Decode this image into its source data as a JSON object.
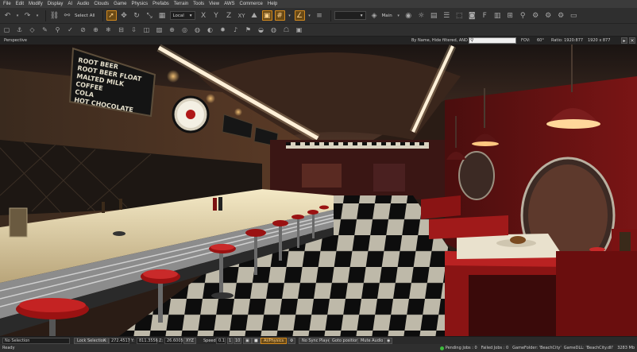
{
  "menu": [
    "File",
    "Edit",
    "Modify",
    "Display",
    "AI",
    "Audio",
    "Clouds",
    "Game",
    "Physics",
    "Prefabs",
    "Terrain",
    "Tools",
    "View",
    "AWS",
    "Commerce",
    "Help"
  ],
  "toolbar": {
    "select_all": "Select All",
    "coord_space": "Local",
    "axis_x": "X",
    "axis_y": "Y",
    "axis_z": "Z",
    "axis_xy": "XY",
    "layer_label": "Main"
  },
  "viewport_header": {
    "view_name": "Perspective",
    "filter_text": "By Name, Hide filtered, AND",
    "search_placeholder": "",
    "fov_label": "FOV:",
    "fov_value": "60°",
    "ratio_label": "Ratio: 1920:877",
    "resolution": "1920 x 877"
  },
  "scene": {
    "menu_board_lines": [
      "ROOT BEER",
      "ROOT BEER FLOAT",
      "MALTED MILK",
      "COFFEE",
      "COLA",
      "HOT CHOCOLATE"
    ]
  },
  "statusbar": {
    "selection": "No Selection",
    "lock_selection": "Lock Selection",
    "x_label": "X:",
    "x_value": "272.4517",
    "y_label": "Y:",
    "y_value": "811.3556",
    "z_label": "Z:",
    "z_value": "26.6005",
    "xyz_toggle": "XYZ",
    "speed_label": "Speed:",
    "speed_value": "0.1",
    "speed_1": "1",
    "speed_10": "10",
    "ai_physics": "AI/Physics",
    "no_sync": "No Sync Player",
    "goto_position": "Goto position",
    "mute_audio": "Mute Audio"
  },
  "status_footer": {
    "ready": "Ready",
    "pending_jobs": "Pending Jobs : 0",
    "failed_jobs": "Failed Jobs : 0",
    "game_folder": "GameFolder: 'BeachCity'",
    "game_dll": "GameDLL: 'BeachCity.dll'",
    "memory": "3283 Mb"
  },
  "colors": {
    "accent": "#d2891e",
    "status_ok": "#3dbb3d"
  }
}
